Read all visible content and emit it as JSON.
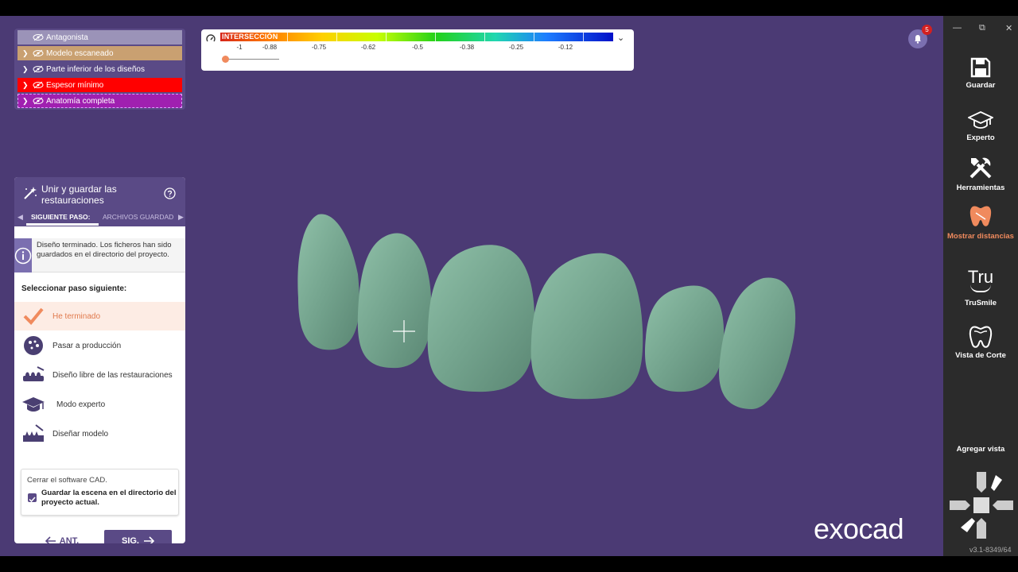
{
  "layers": [
    {
      "label": "Antagonista",
      "color": "#9b93b8",
      "chevron": false
    },
    {
      "label": "Modelo escaneado",
      "color": "#c9a071",
      "chevron": true
    },
    {
      "label": "Parte inferior de los diseños",
      "color": "#5a4a86",
      "chevron": true
    },
    {
      "label": "Espesor mínimo",
      "color": "#ff0000",
      "chevron": true
    },
    {
      "label": "Anatomía completa",
      "color": "#a020b0",
      "chevron": true
    }
  ],
  "scale": {
    "title": "INTERSECCIÓN",
    "ticks": [
      "-1",
      "-0.88",
      "-0.75",
      "-0.62",
      "-0.5",
      "-0.38",
      "-0.25",
      "-0.12"
    ]
  },
  "notifications": {
    "count": "5"
  },
  "wizard": {
    "title": "Unir y guardar las restauraciones",
    "tab_active": "SIGUIENTE PASO:",
    "tab_other": "ARCHIVOS GUARDAD",
    "info": "Diseño terminado. Los ficheros han sido guardados en el directorio del proyecto.",
    "select_label": "Seleccionar paso siguiente:",
    "options": [
      "He terminado",
      "Pasar a producción",
      "Diseño libre de las restauraciones",
      "Modo experto",
      "Diseñar modelo"
    ],
    "close_title": "Cerrar el software CAD.",
    "checkbox_label": "Guardar la escena en el directorio del proyecto actual.",
    "prev": "ANT.",
    "next": "SIG."
  },
  "rightbar": {
    "save": "Guardar",
    "expert": "Experto",
    "tools": "Herramientas",
    "distances": "Mostrar distancias",
    "trusmile_icon_text": "Tru",
    "trusmile": "TruSmile",
    "cut_view": "Vista de Corte",
    "add_view": "Agregar vista",
    "version": "v3.1-8349/64"
  },
  "logo": "exocad",
  "colors": {
    "accent": "#5a4a86",
    "highlight": "#f08a5d",
    "viewport": "#4b3a74"
  }
}
